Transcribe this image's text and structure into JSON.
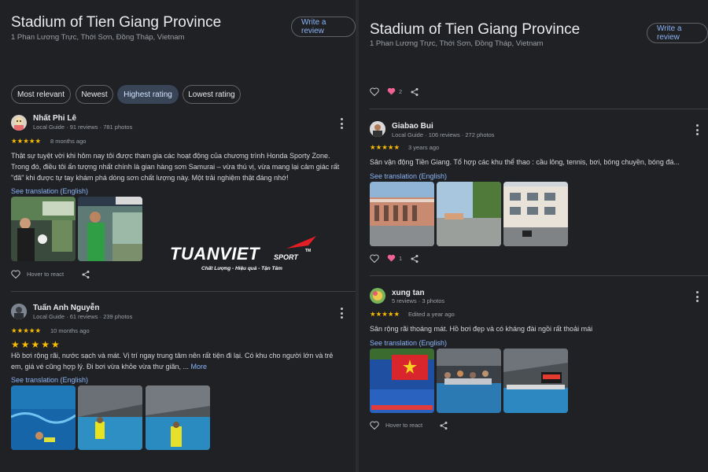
{
  "left": {
    "place_title": "Stadium of Tien Giang Province",
    "place_address": "1 Phan Lương Trực, Thới Sơn, Đồng Tháp, Vietnam",
    "write_review_label": "Write a review",
    "sort_chips": [
      "Most relevant",
      "Newest",
      "Highest rating",
      "Lowest rating"
    ],
    "active_chip": "Highest rating",
    "reviews": [
      {
        "name": "Nhất Phi Lê",
        "meta": "Local Guide · 91 reviews · 781 photos",
        "rating": 5,
        "stars": "★★★★★",
        "ago": "8 months ago",
        "text_line1": "Thật sự tuyệt vời khi hôm nay tôi được tham gia các hoạt động của chương trình Honda Sporty Zone.",
        "text_line2": "Trong đó, điều tôi ấn tượng nhất chính là gian hàng sơn Samurai – vừa thú vị, vừa mang lại cảm giác rất",
        "text_line3": "\"đã\" khi được tự tay khám phá dòng sơn chất lượng này. Một trải nghiệm thật đáng nhớ!",
        "translation": "See translation (English)",
        "react_label": "Hover to react"
      },
      {
        "name": "Tuấn Anh Nguyễn",
        "meta": "Local Guide · 61 reviews · 239 photos",
        "rating": 5,
        "stars": "★★★★★",
        "ago": "10 months ago",
        "emoji_stars": "★★★★★",
        "text_line1": "Hồ bơi rộng rãi, nước sạch và mát. Vị trí ngay trung tâm nên rất tiện đi lại. Có khu cho người lớn và trẻ",
        "text_line2": "em, giá vé cũng hợp lý. Đi bơi vừa khỏe vừa thư giãn, ...",
        "more_label": "More",
        "translation": "See translation (English)"
      }
    ]
  },
  "watermark": {
    "brand": "TUANVIET",
    "brand_suffix": "SPORT",
    "tm": "TM",
    "tagline": "Chất Lượng - Hiệu quả - Tận Tâm",
    "accent": "#e31e24"
  },
  "right": {
    "place_title": "Stadium of Tien Giang Province",
    "place_address": "1 Phan Lương Trực, Thới Sơn, Đồng Tháp, Vietnam",
    "write_review_label": "Write a review",
    "top_like_count": "2",
    "reviews": [
      {
        "name": "Giabao Bui",
        "meta": "Local Guide · 106 reviews · 272 photos",
        "rating": 5,
        "stars": "★★★★★",
        "ago": "3 years ago",
        "text_line1": "Sân vận động Tiền Giang. Tổ hợp các khu thể thao : cầu lông, tennis, bơi, bóng chuyền, bóng đá...",
        "translation": "See translation (English)",
        "like_count": "1"
      },
      {
        "name": "xung tan",
        "meta": "5 reviews · 3 photos",
        "rating": 5,
        "stars": "★★★★★",
        "ago": "Edited a year ago",
        "text_line1": "Sân rộng rãi thoáng mát. Hồ bơi đẹp và có kháng đài ngồi rất thoải mái",
        "translation": "See translation (English)",
        "react_label": "Hover to react"
      }
    ]
  },
  "colors": {
    "background": "#202124",
    "link": "#8ab4f8",
    "star": "#fbbc04",
    "heart": "#f06292",
    "active_chip": "#394457"
  }
}
